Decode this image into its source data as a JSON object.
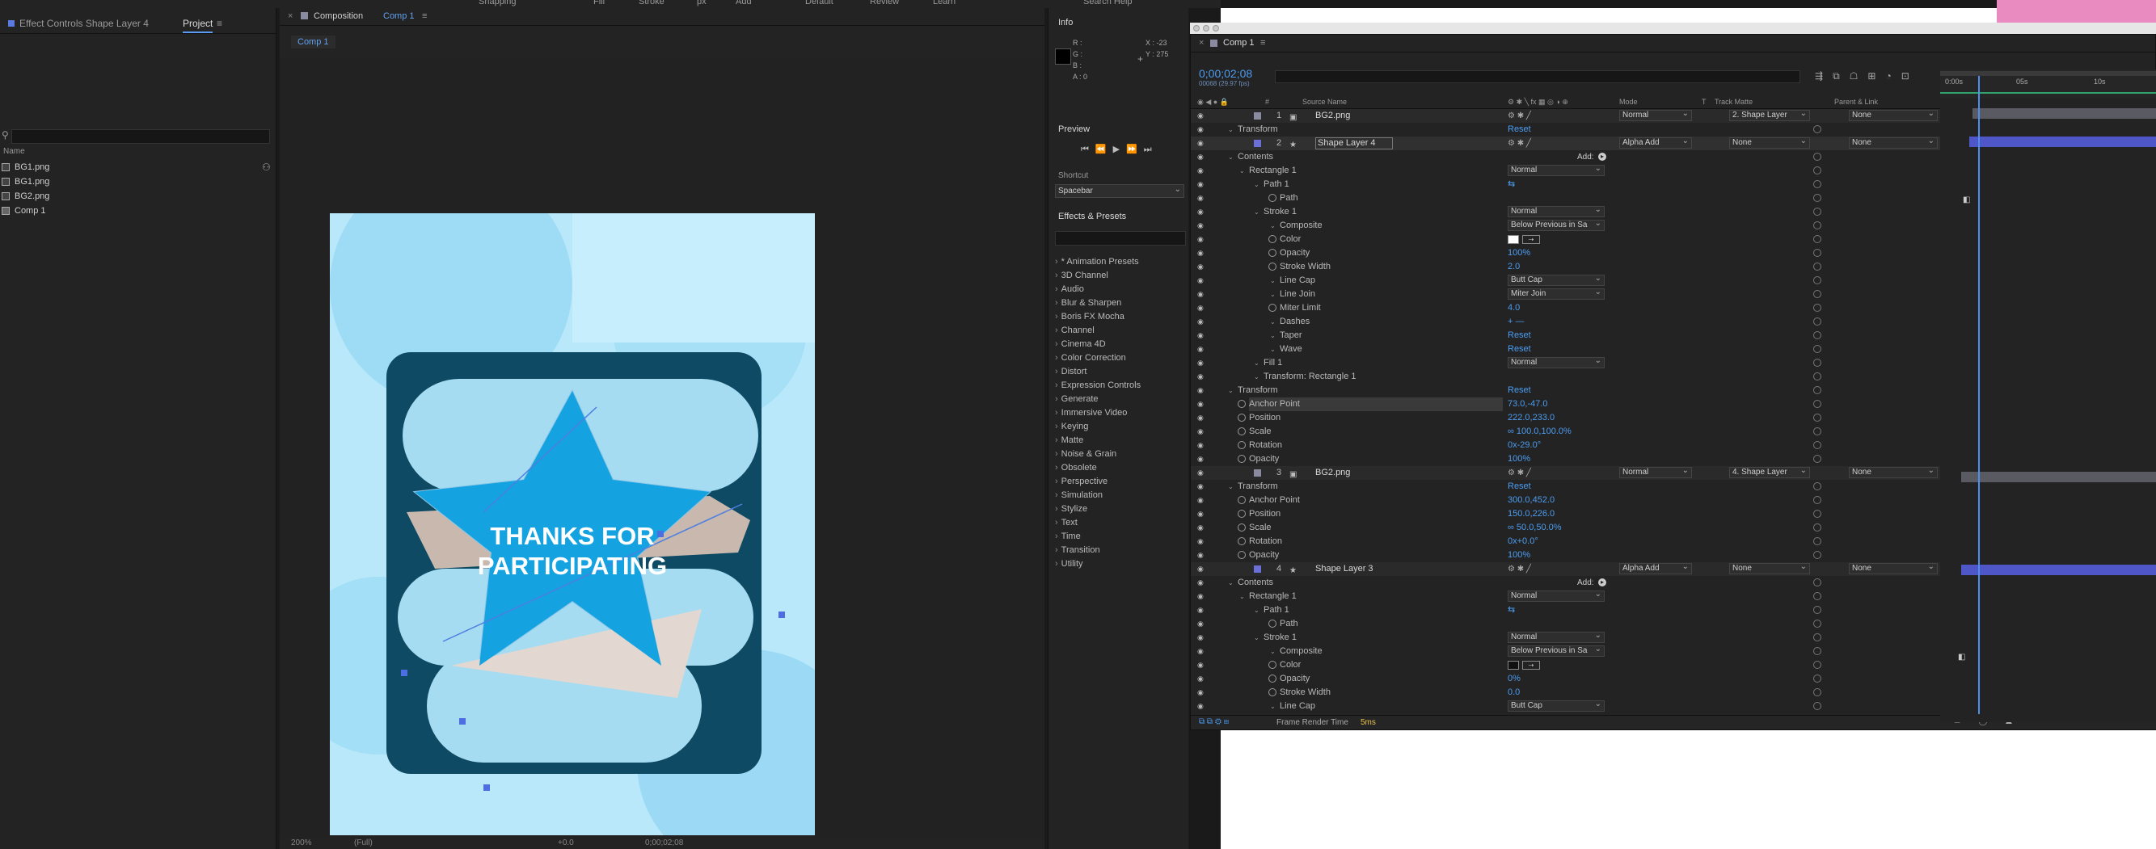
{
  "left_panel": {
    "tabs": [
      "Effect Controls Shape Layer 4",
      "Project"
    ],
    "search_placeholder": "",
    "column_name": "Name",
    "items": [
      "BG1.png",
      "BG1.png",
      "BG2.png",
      "Comp 1"
    ]
  },
  "viewer": {
    "tab_label": "Composition",
    "tab_comp": "Comp 1",
    "subtab": "Comp 1",
    "artwork_line1": "THANKS FOR",
    "artwork_line2": "PARTICIPATING",
    "footer_zoom": "200%",
    "footer_quality": "(Full)",
    "footer_time": "0;00;02;08",
    "footer_exposure": "+0.0"
  },
  "top_strip": {
    "fill": "Fill",
    "stroke": "Stroke",
    "px": "px",
    "add": "Add",
    "snapping": "Snapping",
    "default": "Default",
    "review": "Review",
    "learn": "Learn",
    "search_help": "Search Help"
  },
  "info_panel": {
    "title": "Info",
    "r": "R :",
    "g": "G :",
    "b": "B :",
    "a": "A :  0",
    "x": "X : -23",
    "y": "Y : 275",
    "preview_title": "Preview",
    "shortcut_label": "Shortcut",
    "shortcut_value": "Spacebar",
    "effects_title": "Effects & Presets",
    "effects": [
      "* Animation Presets",
      "3D Channel",
      "Audio",
      "Blur & Sharpen",
      "Boris FX Mocha",
      "Channel",
      "Cinema 4D",
      "Color Correction",
      "Distort",
      "Expression Controls",
      "Generate",
      "Immersive Video",
      "Keying",
      "Matte",
      "Noise & Grain",
      "Obsolete",
      "Perspective",
      "Simulation",
      "Stylize",
      "Text",
      "Time",
      "Transition",
      "Utility"
    ]
  },
  "timeline": {
    "window_title": "Comp 1",
    "timecode": "0;00;02;08",
    "fps": "00068 (29.97 fps)",
    "col_source": "Source Name",
    "col_mode": "Mode",
    "col_t": "T",
    "col_trackmatte": "Track Matte",
    "col_parent": "Parent & Link",
    "ruler": [
      "0:00s",
      "05s",
      "10s"
    ],
    "footer_label": "Frame Render Time",
    "footer_value": "5ms",
    "add_label": "Add:",
    "rows": [
      {
        "indent": 0,
        "num": "1",
        "label": "BG2.png",
        "type": "layer",
        "mode": "Normal",
        "matte": "2. Shape Layer",
        "parent": "None"
      },
      {
        "indent": 1,
        "label": "Transform",
        "val": "Reset"
      },
      {
        "indent": 0,
        "num": "2",
        "label": "Shape Layer 4",
        "type": "layer",
        "sel": true,
        "mode": "Alpha Add",
        "matte": "None",
        "parent": "None"
      },
      {
        "indent": 1,
        "label": "Contents",
        "add": true
      },
      {
        "indent": 2,
        "label": "Rectangle 1",
        "dd": "Normal"
      },
      {
        "indent": 3,
        "label": "Path 1",
        "val": "⇆"
      },
      {
        "indent": 4,
        "label": "Path",
        "stop": true
      },
      {
        "indent": 3,
        "label": "Stroke 1",
        "dd": "Normal"
      },
      {
        "indent": 4,
        "label": "Composite",
        "dd": "Below Previous in Sa"
      },
      {
        "indent": 4,
        "label": "Color",
        "stop": true,
        "swatch": "#ffffff"
      },
      {
        "indent": 4,
        "label": "Opacity",
        "stop": true,
        "val": "100%"
      },
      {
        "indent": 4,
        "label": "Stroke Width",
        "stop": true,
        "val": "2.0"
      },
      {
        "indent": 4,
        "label": "Line Cap",
        "dd": "Butt Cap"
      },
      {
        "indent": 4,
        "label": "Line Join",
        "dd": "Miter Join"
      },
      {
        "indent": 4,
        "label": "Miter Limit",
        "stop": true,
        "val": "4.0"
      },
      {
        "indent": 4,
        "label": "Dashes",
        "val": "+ —"
      },
      {
        "indent": 4,
        "label": "Taper",
        "val": "Reset"
      },
      {
        "indent": 4,
        "label": "Wave",
        "val": "Reset"
      },
      {
        "indent": 3,
        "label": "Fill 1",
        "dd": "Normal"
      },
      {
        "indent": 3,
        "label": "Transform: Rectangle 1"
      },
      {
        "indent": 1,
        "label": "Transform",
        "val": "Reset"
      },
      {
        "indent": 2,
        "label": "Anchor Point",
        "stop": true,
        "val": "73.0,-47.0",
        "hl": true
      },
      {
        "indent": 2,
        "label": "Position",
        "stop": true,
        "val": "222.0,233.0"
      },
      {
        "indent": 2,
        "label": "Scale",
        "stop": true,
        "val": "∞ 100.0,100.0%"
      },
      {
        "indent": 2,
        "label": "Rotation",
        "stop": true,
        "val": "0x-29.0°"
      },
      {
        "indent": 2,
        "label": "Opacity",
        "stop": true,
        "val": "100%"
      },
      {
        "indent": 0,
        "num": "3",
        "label": "BG2.png",
        "type": "layer",
        "mode": "Normal",
        "matte": "4. Shape Layer",
        "parent": "None"
      },
      {
        "indent": 1,
        "label": "Transform",
        "val": "Reset"
      },
      {
        "indent": 2,
        "label": "Anchor Point",
        "stop": true,
        "val": "300.0,452.0"
      },
      {
        "indent": 2,
        "label": "Position",
        "stop": true,
        "val": "150.0,226.0"
      },
      {
        "indent": 2,
        "label": "Scale",
        "stop": true,
        "val": "∞ 50.0,50.0%"
      },
      {
        "indent": 2,
        "label": "Rotation",
        "stop": true,
        "val": "0x+0.0°"
      },
      {
        "indent": 2,
        "label": "Opacity",
        "stop": true,
        "val": "100%"
      },
      {
        "indent": 0,
        "num": "4",
        "label": "Shape Layer 3",
        "type": "layer",
        "mode": "Alpha Add",
        "matte": "None",
        "parent": "None"
      },
      {
        "indent": 1,
        "label": "Contents",
        "add": true
      },
      {
        "indent": 2,
        "label": "Rectangle 1",
        "dd": "Normal"
      },
      {
        "indent": 3,
        "label": "Path 1",
        "val": "⇆"
      },
      {
        "indent": 4,
        "label": "Path",
        "stop": true
      },
      {
        "indent": 3,
        "label": "Stroke 1",
        "dd": "Normal"
      },
      {
        "indent": 4,
        "label": "Composite",
        "dd": "Below Previous in Sa"
      },
      {
        "indent": 4,
        "label": "Color",
        "stop": true,
        "swatch": "#111111"
      },
      {
        "indent": 4,
        "label": "Opacity",
        "stop": true,
        "val": "0%"
      },
      {
        "indent": 4,
        "label": "Stroke Width",
        "stop": true,
        "val": "0.0"
      },
      {
        "indent": 4,
        "label": "Line Cap",
        "dd": "Butt Cap"
      }
    ]
  },
  "colors": {
    "accent": "#4c9cf0",
    "panel": "#232323",
    "artwork_dark": "#0e4a63",
    "artwork_blue": "#13a1e0"
  }
}
